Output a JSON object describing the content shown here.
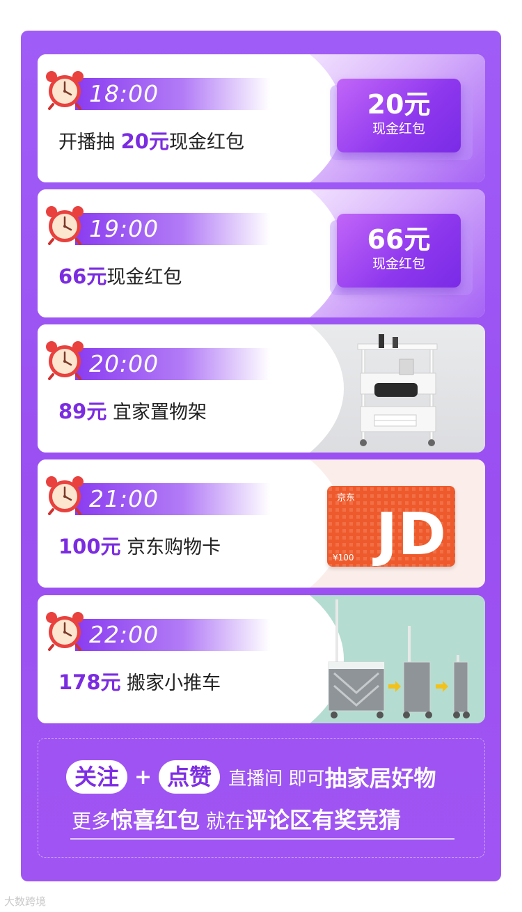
{
  "items": [
    {
      "time": "18:00",
      "prefix": "开播抽 ",
      "amount": "20元",
      "suffix": "现金红包",
      "coupon": {
        "amount": "20元",
        "label": "现金红包"
      }
    },
    {
      "time": "19:00",
      "prefix": "",
      "amount": "66元",
      "suffix": "现金红包",
      "coupon": {
        "amount": "66元",
        "label": "现金红包"
      }
    },
    {
      "time": "20:00",
      "prefix": "",
      "amount": "89元",
      "suffix": " 宜家置物架"
    },
    {
      "time": "21:00",
      "prefix": "",
      "amount": "100元",
      "suffix": " 京东购物卡",
      "jd_card": {
        "brand": "京东",
        "logo": "JD",
        "value": "¥100"
      }
    },
    {
      "time": "22:00",
      "prefix": "",
      "amount": "178元",
      "suffix": " 搬家小推车"
    }
  ],
  "footer": {
    "pill1": "关注",
    "plus": "+",
    "pill2": "点赞",
    "line1_small": "直播间 即可",
    "line1_big": "抽家居好物",
    "line2_small1": "更多",
    "line2_big1": "惊喜红包",
    "line2_small2": " 就在",
    "line2_big2": "评论区有奖竞猜"
  },
  "watermark": "大数跨境",
  "colors": {
    "purple": "#9a4ff1",
    "accent": "#7b2ce0",
    "clock": "#e8413e"
  },
  "icons": [
    "alarm-clock-icon"
  ]
}
